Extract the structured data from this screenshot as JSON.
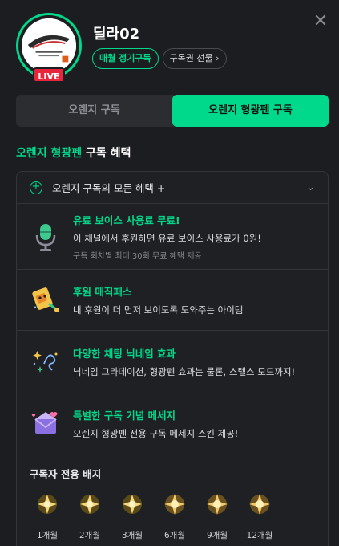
{
  "header": {
    "channel_name": "딜라02",
    "live_label": "LIVE",
    "monthly_tag": "매월 정기구독",
    "gift_button": "구독권 선물",
    "gift_chevron": "›",
    "close_glyph": "✕"
  },
  "tabs": [
    {
      "label": "오렌지 구독",
      "active": false
    },
    {
      "label": "오렌지 형광펜 구독",
      "active": true
    }
  ],
  "section": {
    "accent": "오렌지 형광펜",
    "rest": " 구독 혜택"
  },
  "accordion": {
    "label": "오렌지 구독의 모든 혜택 +",
    "icon": "plus-circle-icon"
  },
  "benefits": [
    {
      "icon": "microphone-icon",
      "title": "유료 보이스 사용료 무료!",
      "desc": "이 채널에서 후원하면 유료 보이스 사용료가 0원!",
      "note": "구독 회차별 최대 30회 무료 혜택 제공"
    },
    {
      "icon": "magic-pass-icon",
      "title": "후원 매직패스",
      "desc": "내 후원이 더 먼저 보이도록 도와주는 아이템",
      "note": ""
    },
    {
      "icon": "sparkle-icon",
      "title": "다양한 채팅 닉네임 효과",
      "desc": "닉네임 그라데이션, 형광펜 효과는 물론, 스텔스 모드까지!",
      "note": ""
    },
    {
      "icon": "envelope-icon",
      "title": "특별한 구독 기념 메세지",
      "desc": "오렌지 형광펜 전용 구독 메세지 스킨 제공!",
      "note": ""
    }
  ],
  "badges": {
    "title": "구독자 전용 배지",
    "items": [
      "1개월",
      "2개월",
      "3개월",
      "6개월",
      "9개월",
      "12개월"
    ]
  },
  "colors": {
    "accent": "#00d98b",
    "live": "#e8253a",
    "background": "#1c1d20"
  }
}
